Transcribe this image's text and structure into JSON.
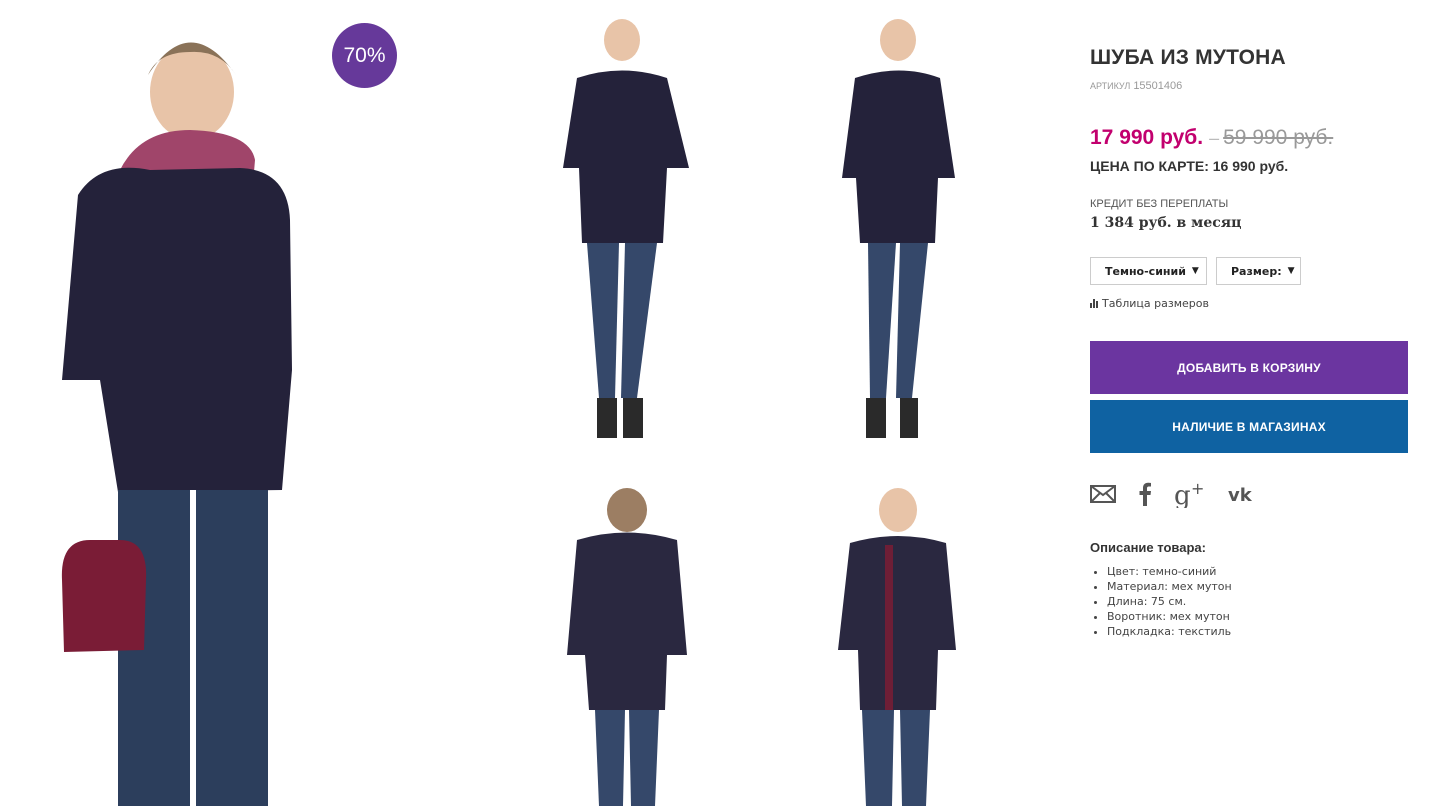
{
  "gallery": {
    "discount_badge": "70%"
  },
  "product": {
    "title": "ШУБА ИЗ МУТОНА",
    "sku_label": "артикул",
    "sku_value": "15501406",
    "price_new": "17 990 руб.",
    "price_dash": "–",
    "price_old": "59 990 руб.",
    "card_price": "ЦЕНА ПО КАРТЕ: 16 990 руб.",
    "credit_label": "КРЕДИТ БЕЗ ПЕРЕПЛАТЫ",
    "credit_value": "1 384 руб. в месяц",
    "color_select": "Темно-синий",
    "size_select": "Размер:",
    "size_table_link": "Таблица размеров",
    "add_to_cart": "ДОБАВИТЬ В КОРЗИНУ",
    "availability": "НАЛИЧИЕ В МАГАЗИНАХ"
  },
  "social": {
    "icons": [
      "mail-icon",
      "facebook-icon",
      "google-plus-icon",
      "vk-icon"
    ]
  },
  "description": {
    "title": "Описание товара:",
    "items": [
      "Цвет: темно-синий",
      "Материал: мех мутон",
      "Длина: 75 см.",
      "Воротник: мех мутон",
      "Подкладка: текстиль"
    ]
  },
  "colors": {
    "price_accent": "#c2006e",
    "badge": "#66399a",
    "cart_button": "#6b35a0",
    "stores_button": "#0f62a2"
  }
}
